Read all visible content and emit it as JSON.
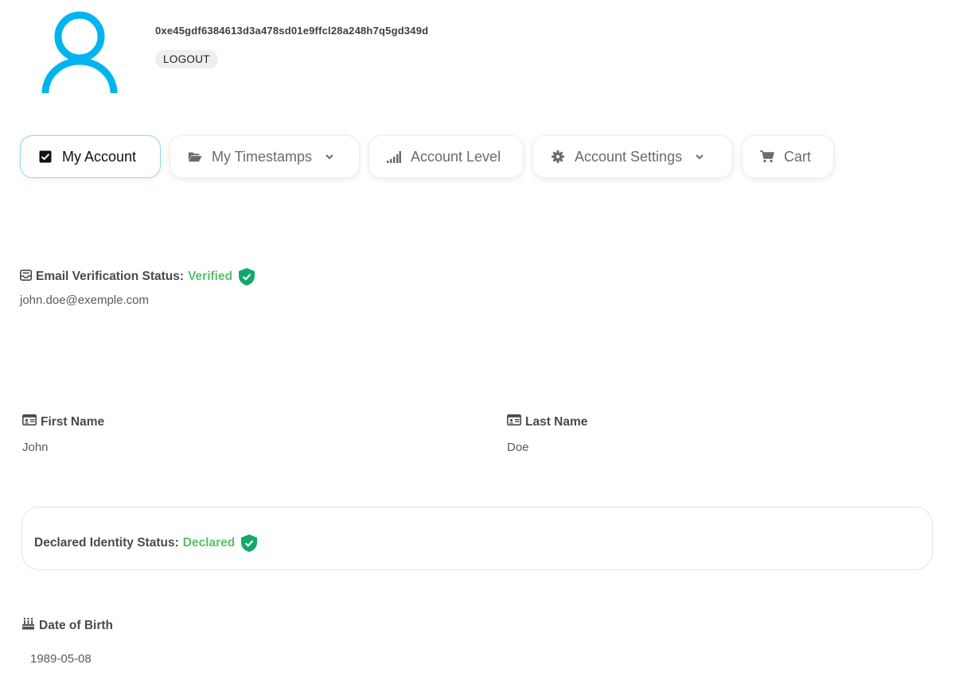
{
  "profile": {
    "wallet_address": "0xe45gdf6384613d3a478sd01e9ffcl28a248h7q5gd349d",
    "logout_label": "LOGOUT",
    "avatar_icon": "user-icon",
    "avatar_color": "#00b4ef"
  },
  "nav": {
    "tabs": [
      {
        "label": "My Account",
        "icon": "checkbox-icon",
        "active": true
      },
      {
        "label": "My Timestamps",
        "icon": "folder-open-icon",
        "dropdown": true
      },
      {
        "label": "Account Level",
        "icon": "signal-icon"
      },
      {
        "label": "Account Settings",
        "icon": "gear-icon",
        "dropdown": true
      },
      {
        "label": "Cart",
        "icon": "cart-icon"
      }
    ]
  },
  "email": {
    "status_label": "Email Verification Status:",
    "status_value": "Verified",
    "address": "john.doe@exemple.com"
  },
  "first_name": {
    "label": "First Name",
    "value": "John"
  },
  "last_name": {
    "label": "Last Name",
    "value": "Doe"
  },
  "identity": {
    "status_label": "Declared Identity Status:",
    "status_value": "Declared"
  },
  "dob": {
    "label": "Date of Birth",
    "value": "1989-05-08"
  },
  "colors": {
    "accent": "#00b4ef",
    "verified_text": "#5cc06b",
    "shield": "#12a86b",
    "active_tab_border": "#8fd7ef"
  }
}
